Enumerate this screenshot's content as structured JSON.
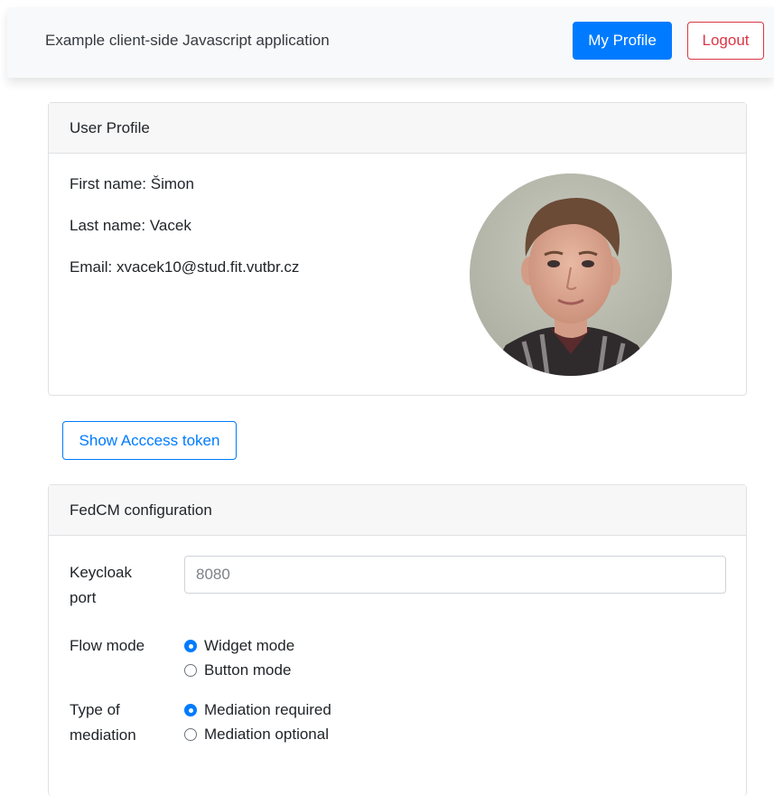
{
  "navbar": {
    "brand": "Example client-side Javascript application",
    "my_profile_label": "My Profile",
    "logout_label": "Logout"
  },
  "profile": {
    "header": "User Profile",
    "first_name": "First name: Šimon",
    "last_name": "Last name: Vacek",
    "email": "Email: xvacek10@stud.fit.vutbr.cz"
  },
  "token_button_label": "Show Acccess token",
  "fedcm": {
    "header": "FedCM configuration",
    "port_label_line1": "Keycloak",
    "port_label_line2": "port",
    "port_placeholder": "8080",
    "flow_label": "Flow mode",
    "flow_options": [
      "Widget mode",
      "Button mode"
    ],
    "flow_selected": "Widget mode",
    "mediation_label_line1": "Type of",
    "mediation_label_line2": "mediation",
    "mediation_options": [
      "Mediation required",
      "Mediation optional"
    ],
    "mediation_selected": "Mediation required"
  },
  "colors": {
    "primary": "#007bff",
    "danger": "#dc3545",
    "navbar_bg": "#f8f9fa"
  }
}
